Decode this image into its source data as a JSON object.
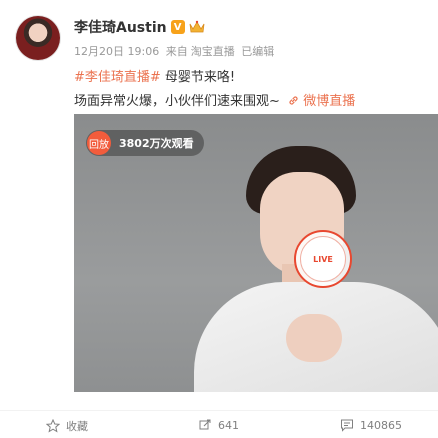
{
  "post": {
    "username": "李佳琦Austin",
    "verified_label": "V",
    "timestamp": "12月20日 19:06",
    "source_prefix": "来自",
    "source": "淘宝直播",
    "edited": "已编辑",
    "hashtag": "#李佳琦直播#",
    "line1_text": " 母婴节来咯!",
    "line2_text": "场面异常火爆，小伙伴们速来围观~",
    "link_label": "微博直播"
  },
  "media": {
    "replay_label": "回放",
    "viewers": "3802万次观看",
    "live_label": "LIVE"
  },
  "actions": {
    "favorite_label": "收藏",
    "repost_count": "641",
    "comment_count": "140865"
  },
  "colors": {
    "accent": "#eb7350",
    "live_red": "#e84830",
    "badge_orange": "#f7a21b"
  }
}
